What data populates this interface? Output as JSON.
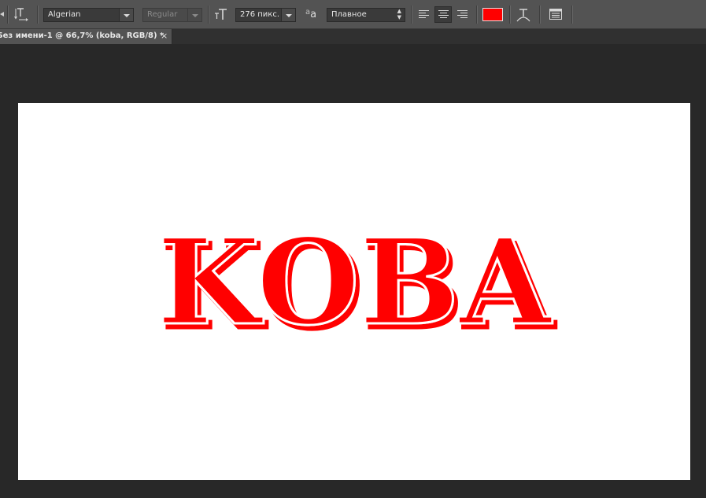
{
  "toolbar": {
    "font_family": "Algerian",
    "font_style": "Regular",
    "font_size": "276 пикс.",
    "antialias_icon_text": "a",
    "antialias_icon_text2": "a",
    "antialias": "Плавное",
    "text_color": "#ff0000",
    "tools": [
      "text-orientation-icon",
      "font-size-icon",
      "antialias-icon",
      "align-left-icon",
      "align-center-icon",
      "align-right-icon",
      "warp-text-icon",
      "character-panel-icon"
    ],
    "active_alignment": "center"
  },
  "document": {
    "tab_title": "Без имени-1 @ 66,7% (koba, RGB/8) *",
    "close_glyph": "×",
    "layer_text": "KOBA",
    "canvas_color": "#ffffff"
  }
}
